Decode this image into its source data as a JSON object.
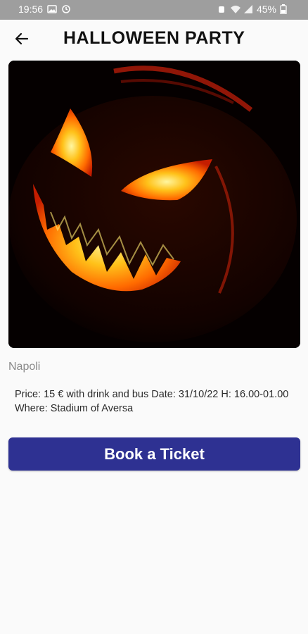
{
  "status_bar": {
    "time": "19:56",
    "battery": "45%",
    "icons": [
      "image-icon",
      "sync-icon",
      "alarm-icon",
      "wifi-icon",
      "signal-icon",
      "battery-icon"
    ]
  },
  "header": {
    "back_icon": "arrow-left-icon",
    "title": "HALLOWEEN PARTY"
  },
  "event": {
    "image": "jack-o-lantern-photo",
    "location": "Napoli",
    "description": "Price: 15 € with drink and bus Date: 31/10/22 H: 16.00-01.00 Where: Stadium of Aversa"
  },
  "actions": {
    "book_label": "Book a Ticket"
  },
  "colors": {
    "status_bar": "#9e9e9e",
    "background": "#fafafa",
    "primary_button": "#2e3192",
    "title_text": "#111111",
    "location_text": "#8a8a8a"
  }
}
